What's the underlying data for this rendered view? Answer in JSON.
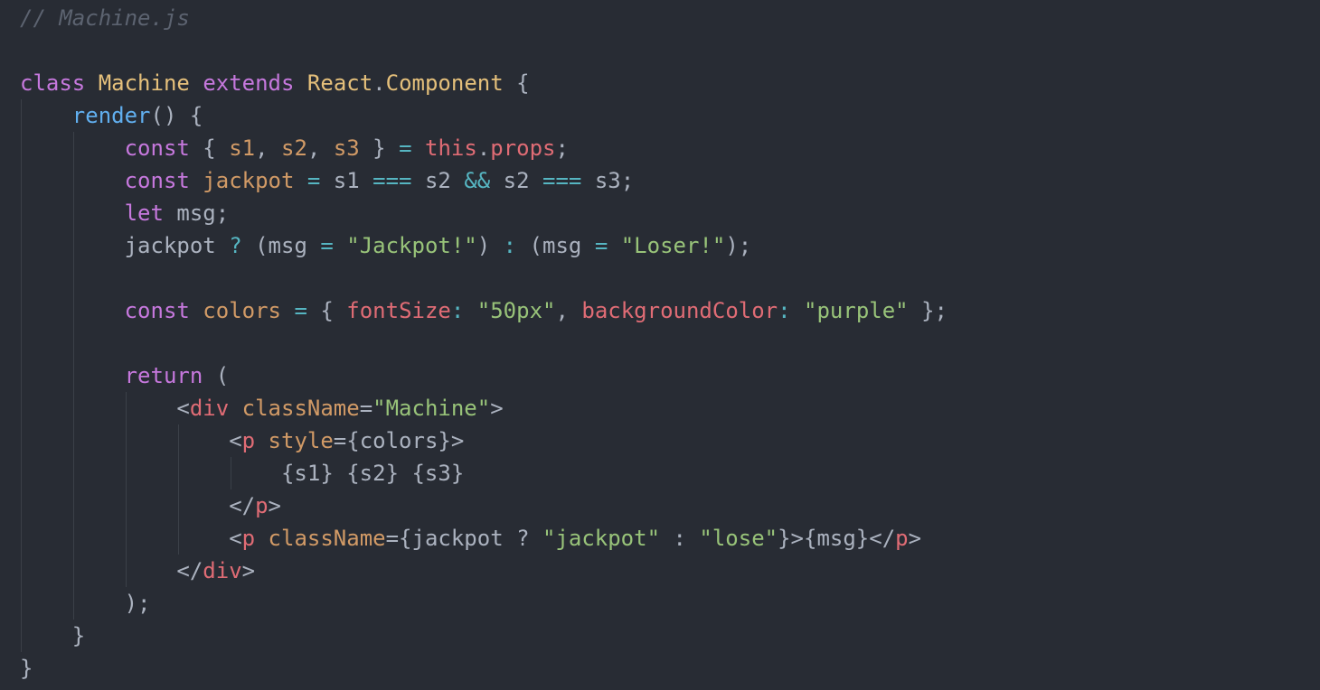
{
  "file": {
    "comment": "// Machine.js"
  },
  "palette": {
    "background": "#282c34",
    "comment": "#5c6370",
    "keyword": "#c678dd",
    "class_name": "#e5c07b",
    "variable": "#d19a66",
    "function": "#61afef",
    "property": "#e06c75",
    "tag": "#e06c75",
    "attribute": "#d19a66",
    "string": "#98c379",
    "operator": "#56b6c2",
    "plain": "#abb2bf",
    "indent_guide": "#3b4048"
  },
  "lines": [
    {
      "tokens": [
        {
          "text": "// Machine.js",
          "kind": "comment"
        }
      ]
    },
    {
      "tokens": []
    },
    {
      "tokens": [
        {
          "text": "class",
          "kind": "keyword"
        },
        {
          "text": " ",
          "kind": "plain"
        },
        {
          "text": "Machine",
          "kind": "class"
        },
        {
          "text": " ",
          "kind": "plain"
        },
        {
          "text": "extends",
          "kind": "keyword"
        },
        {
          "text": " ",
          "kind": "plain"
        },
        {
          "text": "React",
          "kind": "class"
        },
        {
          "text": ".",
          "kind": "plain"
        },
        {
          "text": "Component",
          "kind": "class"
        },
        {
          "text": " {",
          "kind": "plain"
        }
      ]
    },
    {
      "tokens": [
        {
          "text": "    ",
          "kind": "plain"
        },
        {
          "text": "render",
          "kind": "func"
        },
        {
          "text": "() {",
          "kind": "plain"
        }
      ]
    },
    {
      "tokens": [
        {
          "text": "        ",
          "kind": "plain"
        },
        {
          "text": "const",
          "kind": "keyword"
        },
        {
          "text": " { ",
          "kind": "plain"
        },
        {
          "text": "s1",
          "kind": "var"
        },
        {
          "text": ", ",
          "kind": "plain"
        },
        {
          "text": "s2",
          "kind": "var"
        },
        {
          "text": ", ",
          "kind": "plain"
        },
        {
          "text": "s3",
          "kind": "var"
        },
        {
          "text": " } ",
          "kind": "plain"
        },
        {
          "text": "=",
          "kind": "op"
        },
        {
          "text": " ",
          "kind": "plain"
        },
        {
          "text": "this",
          "kind": "prop"
        },
        {
          "text": ".",
          "kind": "plain"
        },
        {
          "text": "props",
          "kind": "prop"
        },
        {
          "text": ";",
          "kind": "plain"
        }
      ]
    },
    {
      "tokens": [
        {
          "text": "        ",
          "kind": "plain"
        },
        {
          "text": "const",
          "kind": "keyword"
        },
        {
          "text": " ",
          "kind": "plain"
        },
        {
          "text": "jackpot",
          "kind": "var"
        },
        {
          "text": " ",
          "kind": "plain"
        },
        {
          "text": "=",
          "kind": "op"
        },
        {
          "text": " s1 ",
          "kind": "plain"
        },
        {
          "text": "===",
          "kind": "op"
        },
        {
          "text": " s2 ",
          "kind": "plain"
        },
        {
          "text": "&&",
          "kind": "op"
        },
        {
          "text": " s2 ",
          "kind": "plain"
        },
        {
          "text": "===",
          "kind": "op"
        },
        {
          "text": " s3;",
          "kind": "plain"
        }
      ]
    },
    {
      "tokens": [
        {
          "text": "        ",
          "kind": "plain"
        },
        {
          "text": "let",
          "kind": "keyword"
        },
        {
          "text": " msg;",
          "kind": "plain"
        }
      ]
    },
    {
      "tokens": [
        {
          "text": "        jackpot ",
          "kind": "plain"
        },
        {
          "text": "?",
          "kind": "op"
        },
        {
          "text": " (msg ",
          "kind": "plain"
        },
        {
          "text": "=",
          "kind": "op"
        },
        {
          "text": " ",
          "kind": "plain"
        },
        {
          "text": "\"Jackpot!\"",
          "kind": "string"
        },
        {
          "text": ") ",
          "kind": "plain"
        },
        {
          "text": ":",
          "kind": "op"
        },
        {
          "text": " (msg ",
          "kind": "plain"
        },
        {
          "text": "=",
          "kind": "op"
        },
        {
          "text": " ",
          "kind": "plain"
        },
        {
          "text": "\"Loser!\"",
          "kind": "string"
        },
        {
          "text": ");",
          "kind": "plain"
        }
      ]
    },
    {
      "tokens": []
    },
    {
      "tokens": [
        {
          "text": "        ",
          "kind": "plain"
        },
        {
          "text": "const",
          "kind": "keyword"
        },
        {
          "text": " ",
          "kind": "plain"
        },
        {
          "text": "colors",
          "kind": "var"
        },
        {
          "text": " ",
          "kind": "plain"
        },
        {
          "text": "=",
          "kind": "op"
        },
        {
          "text": " { ",
          "kind": "plain"
        },
        {
          "text": "fontSize",
          "kind": "prop"
        },
        {
          "text": ":",
          "kind": "op"
        },
        {
          "text": " ",
          "kind": "plain"
        },
        {
          "text": "\"50px\"",
          "kind": "string"
        },
        {
          "text": ", ",
          "kind": "plain"
        },
        {
          "text": "backgroundColor",
          "kind": "prop"
        },
        {
          "text": ":",
          "kind": "op"
        },
        {
          "text": " ",
          "kind": "plain"
        },
        {
          "text": "\"purple\"",
          "kind": "string"
        },
        {
          "text": " };",
          "kind": "plain"
        }
      ]
    },
    {
      "tokens": []
    },
    {
      "tokens": [
        {
          "text": "        ",
          "kind": "plain"
        },
        {
          "text": "return",
          "kind": "keyword"
        },
        {
          "text": " (",
          "kind": "plain"
        }
      ]
    },
    {
      "tokens": [
        {
          "text": "            <",
          "kind": "plain"
        },
        {
          "text": "div",
          "kind": "tag"
        },
        {
          "text": " ",
          "kind": "plain"
        },
        {
          "text": "className",
          "kind": "attr"
        },
        {
          "text": "=",
          "kind": "plain"
        },
        {
          "text": "\"Machine\"",
          "kind": "string"
        },
        {
          "text": ">",
          "kind": "plain"
        }
      ]
    },
    {
      "tokens": [
        {
          "text": "                <",
          "kind": "plain"
        },
        {
          "text": "p",
          "kind": "tag"
        },
        {
          "text": " ",
          "kind": "plain"
        },
        {
          "text": "style",
          "kind": "attr"
        },
        {
          "text": "={colors}>",
          "kind": "plain"
        }
      ]
    },
    {
      "tokens": [
        {
          "text": "                    {s1} {s2} {s3}",
          "kind": "plain"
        }
      ]
    },
    {
      "tokens": [
        {
          "text": "                </",
          "kind": "plain"
        },
        {
          "text": "p",
          "kind": "tag"
        },
        {
          "text": ">",
          "kind": "plain"
        }
      ]
    },
    {
      "tokens": [
        {
          "text": "                <",
          "kind": "plain"
        },
        {
          "text": "p",
          "kind": "tag"
        },
        {
          "text": " ",
          "kind": "plain"
        },
        {
          "text": "className",
          "kind": "attr"
        },
        {
          "text": "={jackpot ? ",
          "kind": "plain"
        },
        {
          "text": "\"jackpot\"",
          "kind": "string"
        },
        {
          "text": " : ",
          "kind": "plain"
        },
        {
          "text": "\"lose\"",
          "kind": "string"
        },
        {
          "text": "}>{msg}</",
          "kind": "plain"
        },
        {
          "text": "p",
          "kind": "tag"
        },
        {
          "text": ">",
          "kind": "plain"
        }
      ]
    },
    {
      "tokens": [
        {
          "text": "            </",
          "kind": "plain"
        },
        {
          "text": "div",
          "kind": "tag"
        },
        {
          "text": ">",
          "kind": "plain"
        }
      ]
    },
    {
      "tokens": [
        {
          "text": "        );",
          "kind": "plain"
        }
      ]
    },
    {
      "tokens": [
        {
          "text": "    }",
          "kind": "plain"
        }
      ]
    },
    {
      "tokens": [
        {
          "text": "}",
          "kind": "plain"
        }
      ]
    }
  ]
}
